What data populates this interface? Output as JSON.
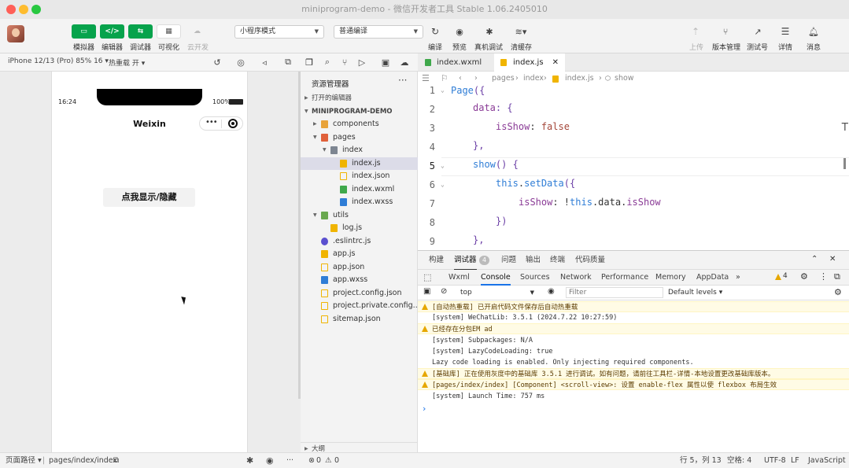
{
  "window": {
    "title": "miniprogram-demo - 微信开发者工具 Stable 1.06.2405010",
    "traffic": {
      "close": "#ff5f57",
      "min": "#febc2e",
      "max": "#28c840"
    }
  },
  "toolbar": {
    "left_buttons": [
      {
        "label": "模拟器",
        "glyph": "▭"
      },
      {
        "label": "编辑器",
        "glyph": "</>"
      },
      {
        "label": "调试器",
        "glyph": "⇆"
      },
      {
        "label": "可视化",
        "glyph": "▦"
      },
      {
        "label": "云开发",
        "glyph": "☁"
      }
    ],
    "mode_select": "小程序模式",
    "compile_select": "普通编译",
    "mid_buttons": [
      "编译",
      "预览",
      "真机调试",
      "清缓存"
    ],
    "right_buttons": [
      "上传",
      "版本管理",
      "测试号",
      "详情",
      "消息"
    ]
  },
  "simulator_bar": {
    "device": "iPhone 12/13 (Pro) 85% 16",
    "hot_reload": "热重载 开"
  },
  "phone": {
    "time": "16:24",
    "battery": "100%",
    "nav_title": "Weixin",
    "button_label": "点我显示/隐藏"
  },
  "explorer": {
    "title": "资源管理器",
    "open_editors": "打开的编辑器",
    "project": "MINIPROGRAM-DEMO",
    "outline": "大纲",
    "items": [
      {
        "name": "components",
        "level": 1,
        "kind": "folder-orange",
        "twisty": "▶"
      },
      {
        "name": "pages",
        "level": 1,
        "kind": "folder-red",
        "twisty": "▼"
      },
      {
        "name": "index",
        "level": 2,
        "kind": "folder-gray",
        "twisty": "▼"
      },
      {
        "name": "index.js",
        "level": 3,
        "kind": "js",
        "twisty": ""
      },
      {
        "name": "index.json",
        "level": 3,
        "kind": "json",
        "twisty": ""
      },
      {
        "name": "index.wxml",
        "level": 3,
        "kind": "wxml",
        "twisty": ""
      },
      {
        "name": "index.wxss",
        "level": 3,
        "kind": "wxss",
        "twisty": ""
      },
      {
        "name": "utils",
        "level": 1,
        "kind": "folder-green",
        "twisty": "▼"
      },
      {
        "name": "log.js",
        "level": 2,
        "kind": "js",
        "twisty": ""
      },
      {
        "name": ".eslintrc.js",
        "level": 1,
        "kind": "eslint",
        "twisty": ""
      },
      {
        "name": "app.js",
        "level": 1,
        "kind": "js",
        "twisty": ""
      },
      {
        "name": "app.json",
        "level": 1,
        "kind": "json",
        "twisty": ""
      },
      {
        "name": "app.wxss",
        "level": 1,
        "kind": "wxss",
        "twisty": ""
      },
      {
        "name": "project.config.json",
        "level": 1,
        "kind": "json",
        "twisty": ""
      },
      {
        "name": "project.private.config...",
        "level": 1,
        "kind": "json",
        "twisty": ""
      },
      {
        "name": "sitemap.json",
        "level": 1,
        "kind": "json",
        "twisty": ""
      }
    ]
  },
  "editor": {
    "tabs": [
      {
        "label": "index.wxml",
        "active": false
      },
      {
        "label": "index.js",
        "active": true
      }
    ],
    "breadcrumb": [
      "pages",
      "index",
      "index.js",
      "show"
    ],
    "lines": [
      {
        "n": "1",
        "fold": true
      },
      {
        "n": "2",
        "fold": false
      },
      {
        "n": "3",
        "fold": false
      },
      {
        "n": "4",
        "fold": false
      },
      {
        "n": "5",
        "fold": true
      },
      {
        "n": "6",
        "fold": true
      },
      {
        "n": "7",
        "fold": false
      },
      {
        "n": "8",
        "fold": false
      },
      {
        "n": "9",
        "fold": false
      }
    ],
    "code": {
      "l1a": "Page",
      "l1b": "({",
      "l2a": "data",
      "l2b": ": {",
      "l3a": "isShow",
      "l3b": ": ",
      "l3c": "false",
      "l4": "},",
      "l5a": "show",
      "l5b": "() {",
      "l6a": "this",
      "l6b": ".",
      "l6c": "setData",
      "l6d": "({",
      "l7a": "isShow",
      "l7b": ": !",
      "l7c": "this",
      "l7d": ".data.",
      "l7e": "isShow",
      "l8": "})",
      "l9": "},"
    }
  },
  "panel": {
    "top_tabs": [
      "构建",
      "调试器",
      "问题",
      "输出",
      "终端",
      "代码质量"
    ],
    "debugger_badge": "4",
    "devtools_tabs": [
      "Wxml",
      "Console",
      "Sources",
      "Network",
      "Performance",
      "Memory",
      "AppData"
    ],
    "warn_count": "4",
    "context": "top",
    "filter_placeholder": "Filter",
    "levels": "Default levels",
    "logs": [
      {
        "text": "[自动热重载] 已开启代码文件保存后自动热重载",
        "warn": true
      },
      {
        "text": "[system] WeChatLib: 3.5.1 (2024.7.22 10:27:59)",
        "warn": false
      },
      {
        "text": "已经存在分包EM ad",
        "warn": true
      },
      {
        "text": "[system] Subpackages: N/A",
        "warn": false
      },
      {
        "text": "[system] LazyCodeLoading: true",
        "warn": false
      },
      {
        "text": "Lazy code loading is enabled. Only injecting required components.",
        "warn": false
      },
      {
        "text": "[基础库] 正在使用灰度中的基础库 3.5.1 进行调试。如有问题，请前往工具栏-详情-本地设置更改基础库版本。",
        "warn": true
      },
      {
        "text": "[pages/index/index] [Component] <scroll-view>: 设置 enable-flex 属性以使 flexbox 布局生效",
        "warn": true
      },
      {
        "text": "[system] Launch Time: 757 ms",
        "warn": false
      }
    ],
    "prompt": "›"
  },
  "statusbar": {
    "page_path_label": "页面路径",
    "page_path": "pages/index/index",
    "errors": "0",
    "warnings": "0",
    "cursor": "行 5，列 13",
    "spaces": "空格: 4",
    "encoding": "UTF-8",
    "eol": "LF",
    "language": "JavaScript"
  }
}
